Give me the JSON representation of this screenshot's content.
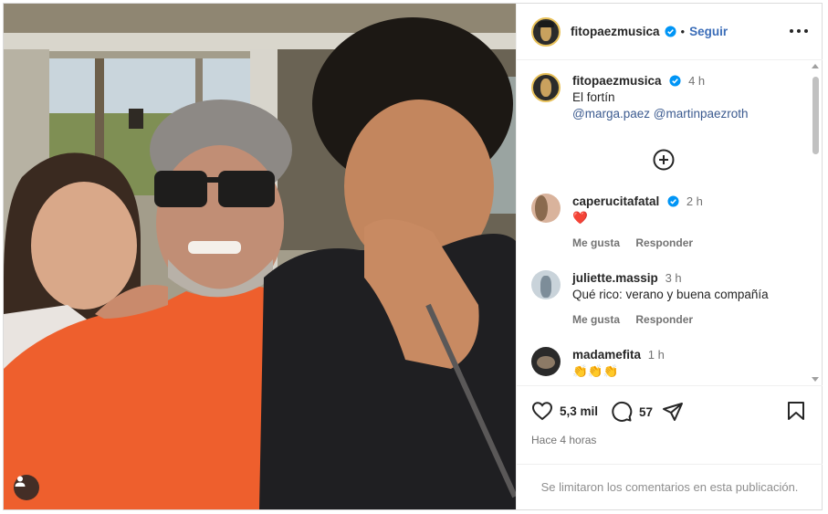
{
  "post": {
    "author": "fitopaezmusica",
    "follow_label": "Seguir",
    "separator": "•",
    "more_icon": "more-horizontal-icon"
  },
  "caption": {
    "author": "fitopaezmusica",
    "time": "4 h",
    "text": "El fortín",
    "mentions": [
      "@marga.paez",
      "@martinpaezroth"
    ]
  },
  "comments": [
    {
      "user": "caperucitafatal",
      "verified": true,
      "time": "2 h",
      "text": "❤️",
      "like_label": "Me gusta",
      "reply_label": "Responder"
    },
    {
      "user": "juliette.massip",
      "verified": false,
      "time": "3 h",
      "text": "Qué rico: verano y buena compañía",
      "like_label": "Me gusta",
      "reply_label": "Responder"
    },
    {
      "user": "madamefita",
      "verified": false,
      "time": "1 h",
      "text": "👏👏👏"
    }
  ],
  "stats": {
    "likes": "5,3 mil",
    "comments": "57",
    "timestamp": "Hace 4 horas"
  },
  "footer": {
    "limited_text": "Se limitaron los comentarios en esta publicación."
  },
  "colors": {
    "verified": "#0095f6",
    "link": "#3b5a8f",
    "follow": "#3b6db8"
  }
}
